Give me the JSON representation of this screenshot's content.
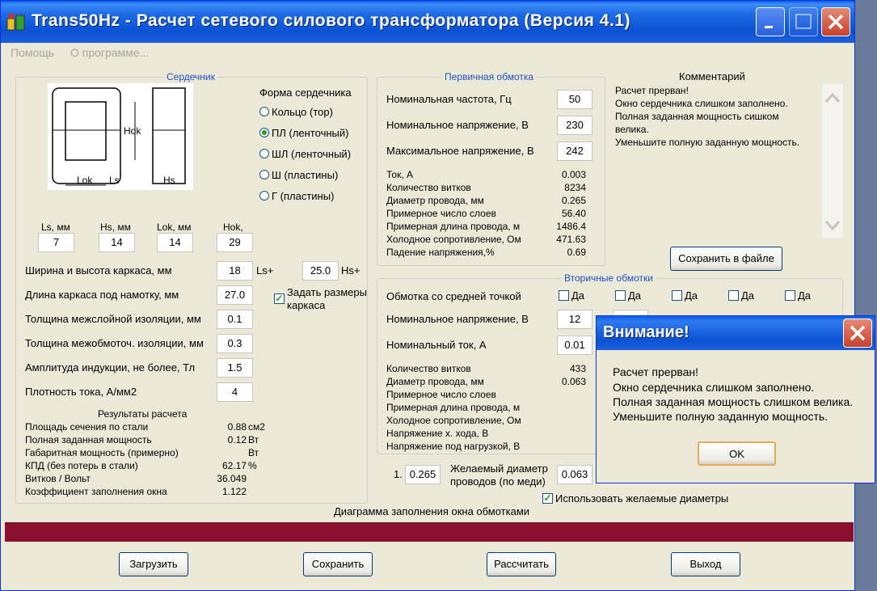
{
  "window": {
    "title": "Trans50Hz - Расчет сетевого силового трансформатора (Версия 4.1)"
  },
  "menu": [
    "Помощь",
    "О программе..."
  ],
  "core": {
    "title": "Сердечник",
    "shape_title": "Форма сердечника",
    "shapes": [
      "Кольцо (тор)",
      "ПЛ (ленточный)",
      "ШЛ (ленточный)",
      "Ш (пластины)",
      "Г (пластины)"
    ],
    "drawing": {
      "hok": "Hok",
      "lok": "Lok",
      "ls": "Ls",
      "hs": "Hs"
    },
    "dims": [
      {
        "label": "Ls, мм",
        "value": "7"
      },
      {
        "label": "Hs, мм",
        "value": "14"
      },
      {
        "label": "Lok, мм",
        "value": "14"
      },
      {
        "label": "Hok,",
        "value": "29"
      }
    ],
    "frame_label": "Ширина и высота каркаса, мм",
    "frame_w": "18",
    "ls_plus": "Ls+",
    "frame_h": "25.0",
    "hs_plus": "Hs+",
    "length_label": "Длина каркаса под намотку, мм",
    "length": "27.0",
    "set_frame": "Задать размеры каркаса",
    "interlayer_label": "Толщина межслойной изоляции, мм",
    "interlayer": "0.1",
    "interwinding_label": "Толщина межобмоточ. изоляции, мм",
    "interwinding": "0.3",
    "induction_label": "Амплитуда индукции, не более, Тл",
    "induction": "1.5",
    "current_density_label": "Плотность тока, А/мм2",
    "current_density": "4",
    "results_title": "Результаты расчета",
    "results": [
      {
        "label": "Площадь сечения по стали",
        "value": "0.88",
        "unit": "см2"
      },
      {
        "label": "Полная заданная мощность",
        "value": "0.12",
        "unit": "Вт"
      },
      {
        "label": "Габаритная мощность (примерно)",
        "value": "",
        "unit": "Вт"
      },
      {
        "label": "КПД (без потерь в стали)",
        "value": "62.17",
        "unit": "%"
      },
      {
        "label": "Витков / Вольт",
        "value": "36.049",
        "unit": ""
      },
      {
        "label": "Коэффициент заполнения окна",
        "value": "1.122",
        "unit": ""
      }
    ]
  },
  "primary": {
    "title": "Первичная обмотка",
    "inputs": [
      {
        "label": "Номинальная частота, Гц",
        "value": "50"
      },
      {
        "label": "Номинальное напряжение, В",
        "value": "230"
      },
      {
        "label": "Максимальное напряжение, В",
        "value": "242"
      }
    ],
    "rows": [
      {
        "label": "Ток, А",
        "value": "0.003"
      },
      {
        "label": "Количество витков",
        "value": "8234"
      },
      {
        "label": "Диаметр провода, мм",
        "value": "0.265"
      },
      {
        "label": "Примерное число слоев",
        "value": "56.40"
      },
      {
        "label": "Примерная длина провода, м",
        "value": "1486.4"
      },
      {
        "label": "Холодное сопротивление, Ом",
        "value": "471.63"
      },
      {
        "label": "Падение напряжения,%",
        "value": "0.69"
      }
    ]
  },
  "comment": {
    "title": "Комментарий",
    "lines": [
      "Расчет прерван!",
      "Окно сердечника слишком заполнено.",
      "Полная заданная мощность сишком",
      "велика.",
      "Уменьшите полную заданную мощность."
    ],
    "save": "Сохранить в файле"
  },
  "secondary": {
    "title": "Вторичные обмотки",
    "center_tap": "Обмотка со средней точкой",
    "yes": "Да",
    "voltage_label": "Номинальное напряжение, В",
    "voltage": "12",
    "current_label": "Номинальный ток, А",
    "current": "0.01",
    "rows": [
      {
        "label": "Количество витков",
        "value": "433"
      },
      {
        "label": "Диаметр провода, мм",
        "value": "0.063"
      },
      {
        "label": "Примерное число слоев",
        "value": ""
      },
      {
        "label": "Примерная длина провода, м",
        "value": ""
      },
      {
        "label": "Холодное сопротивление, Ом",
        "value": ""
      },
      {
        "label": "Напряжение х. хода, В",
        "value": ""
      },
      {
        "label": "Напряжение под нагрузкой, В",
        "value": ""
      }
    ],
    "desired_num": "1.",
    "desired_primary": "0.265",
    "desired_label": "Желаемый диаметр проводов  (по меди)",
    "desired_secondary": "0.063",
    "use_desired": "Использовать желаемые диаметры"
  },
  "diagram": {
    "title": "Диаграмма заполнения окна обмотками"
  },
  "buttons": {
    "load": "Загрузить",
    "save": "Сохранить",
    "calc": "Рассчитать",
    "exit": "Выход"
  },
  "dialog": {
    "title": "Внимание!",
    "lines": [
      "Расчет прерван!",
      "Окно сердечника слишком заполнено.",
      "Полная заданная мощность слишком велика.",
      "Уменьшите полную заданную мощность."
    ],
    "ok": "OK"
  },
  "colors": {
    "title_blue": "#0b52d4",
    "group_title": "#1d50c8",
    "diagram_bar": "#8b0f2f",
    "window_bg": "#ece9d8"
  }
}
